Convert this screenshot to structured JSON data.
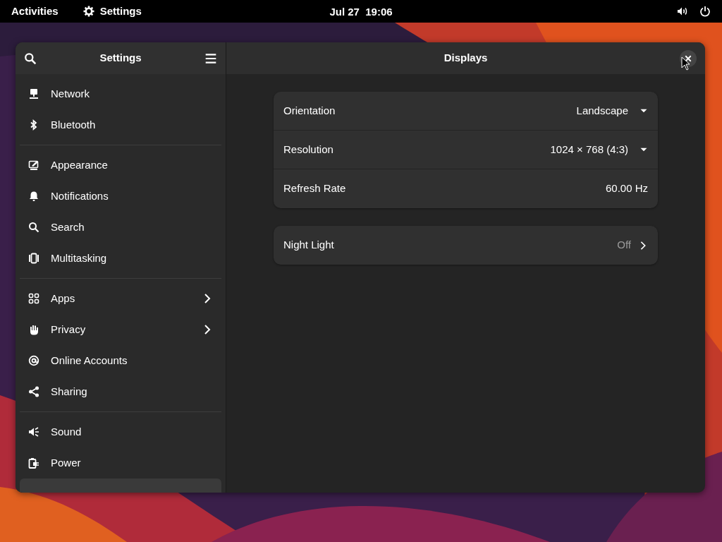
{
  "top_bar": {
    "activities": "Activities",
    "app_name": "Settings",
    "clock": "Jul 27  19:06"
  },
  "sidebar": {
    "title": "Settings",
    "groups": [
      [
        {
          "label": "Network",
          "kind": "plain",
          "selected": false
        },
        {
          "label": "Bluetooth",
          "kind": "plain",
          "selected": false
        }
      ],
      [
        {
          "label": "Appearance",
          "kind": "plain",
          "selected": false
        },
        {
          "label": "Notifications",
          "kind": "plain",
          "selected": false
        },
        {
          "label": "Search",
          "kind": "plain",
          "selected": false
        },
        {
          "label": "Multitasking",
          "kind": "plain",
          "selected": false
        }
      ],
      [
        {
          "label": "Apps",
          "kind": "submenu",
          "selected": false
        },
        {
          "label": "Privacy",
          "kind": "submenu",
          "selected": false
        },
        {
          "label": "Online Accounts",
          "kind": "plain",
          "selected": false
        },
        {
          "label": "Sharing",
          "kind": "plain",
          "selected": false
        }
      ],
      [
        {
          "label": "Sound",
          "kind": "plain",
          "selected": false
        },
        {
          "label": "Power",
          "kind": "plain",
          "selected": false
        },
        {
          "kind": "plain",
          "selected": true
        }
      ]
    ]
  },
  "content": {
    "title": "Displays",
    "cards": [
      [
        {
          "label": "Orientation",
          "value": "Landscape",
          "kind": "dropdown"
        },
        {
          "label": "Resolution",
          "value": "1024 × 768 (4:3)",
          "kind": "dropdown"
        },
        {
          "label": "Refresh Rate",
          "value": "60.00 Hz",
          "kind": "value"
        }
      ],
      [
        {
          "label": "Night Light",
          "value": "Off",
          "kind": "link"
        }
      ]
    ]
  }
}
